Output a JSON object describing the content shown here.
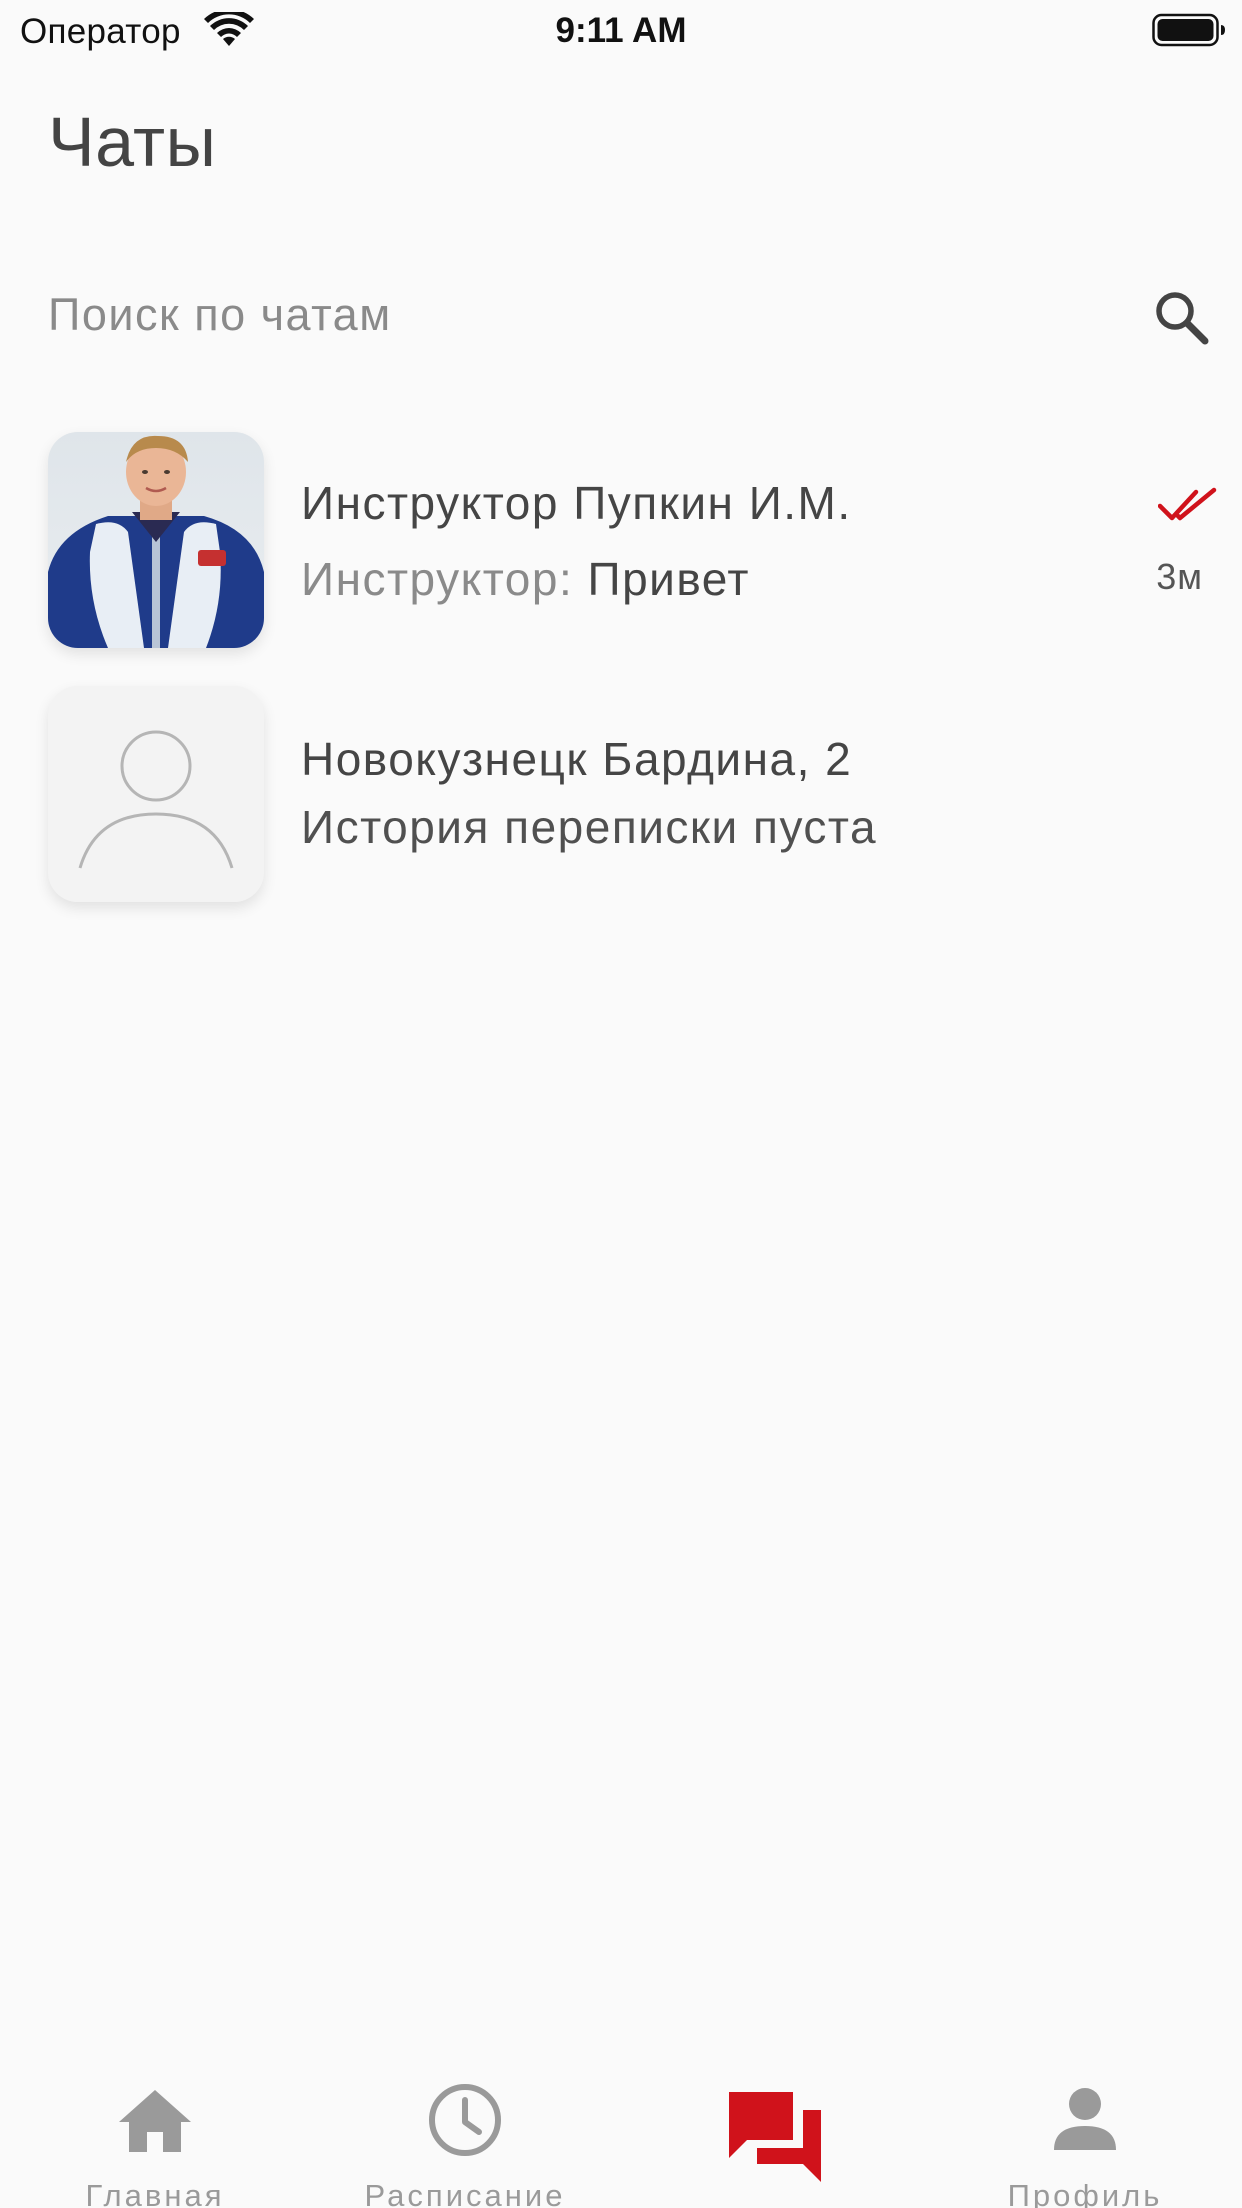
{
  "status_bar": {
    "carrier": "Оператор",
    "time": "9:11 AM",
    "wifi_icon": "wifi-icon",
    "battery_icon": "battery-icon"
  },
  "header": {
    "title": "Чаты"
  },
  "search": {
    "placeholder": "Поиск по чатам",
    "value": "",
    "icon": "search-icon"
  },
  "chats": [
    {
      "name": "Инструктор Пупкин И.М.",
      "sender_label": "Инструктор:",
      "message": " Привет",
      "time": "3м",
      "status_icon": "double-check-icon",
      "avatar": "instructor-photo"
    },
    {
      "name": "Новокузнецк Бардина, 2",
      "message": "История переписки пуста",
      "avatar": "person-placeholder-icon"
    }
  ],
  "tab_bar": {
    "items": [
      {
        "label": "Главная",
        "icon": "home-icon",
        "active": false
      },
      {
        "label": "Расписание",
        "icon": "clock-icon",
        "active": false
      },
      {
        "label": "",
        "icon": "chats-icon",
        "active": true
      },
      {
        "label": "Профиль",
        "icon": "person-icon",
        "active": false
      }
    ]
  },
  "colors": {
    "accent": "#d0121b",
    "background": "#fafafa",
    "inactive_icon": "#9a9a9a",
    "text_primary": "#454545",
    "text_secondary": "#8a8a8a"
  }
}
